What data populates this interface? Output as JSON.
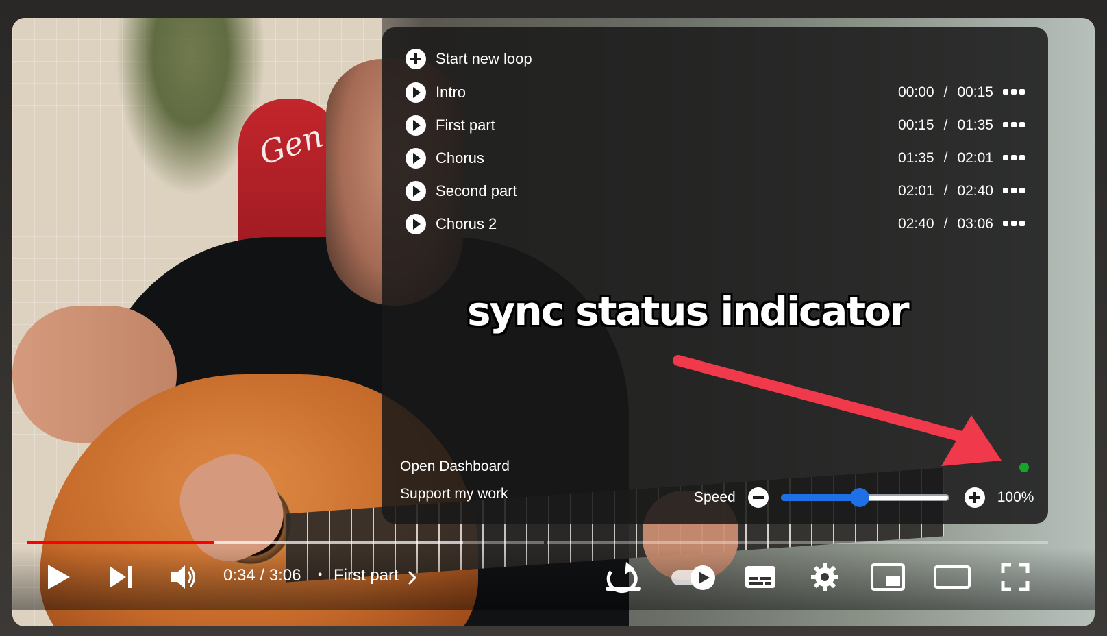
{
  "panel": {
    "start_new_loop": "Start new loop",
    "loops": [
      {
        "name": "Intro",
        "start": "00:00",
        "end": "00:15"
      },
      {
        "name": "First part",
        "start": "00:15",
        "end": "01:35"
      },
      {
        "name": "Chorus",
        "start": "01:35",
        "end": "02:01"
      },
      {
        "name": "Second part",
        "start": "02:01",
        "end": "02:40"
      },
      {
        "name": "Chorus 2",
        "start": "02:40",
        "end": "03:06"
      }
    ],
    "time_separator": "/",
    "open_dashboard": "Open Dashboard",
    "support": "Support my work",
    "speed_label": "Speed",
    "speed_value": "100%",
    "speed_slider_fraction": 0.47,
    "sync_status_color": "#14a62c"
  },
  "annotation": {
    "text": "sync status indicator",
    "arrow_color": "#f0394a"
  },
  "player": {
    "time": "0:34 / 3:06",
    "bullet": "•",
    "chapter": "First part",
    "progress_fraction": 0.183,
    "buffered_fraction": 0.427,
    "accent_color": "#ff0000",
    "icons": [
      "play-icon",
      "next-icon",
      "volume-icon",
      "chevron-right-icon",
      "loop-icon",
      "autoplay-toggle-icon",
      "subtitles-icon",
      "settings-gear-icon",
      "miniplayer-icon",
      "theater-mode-icon",
      "fullscreen-icon"
    ]
  }
}
